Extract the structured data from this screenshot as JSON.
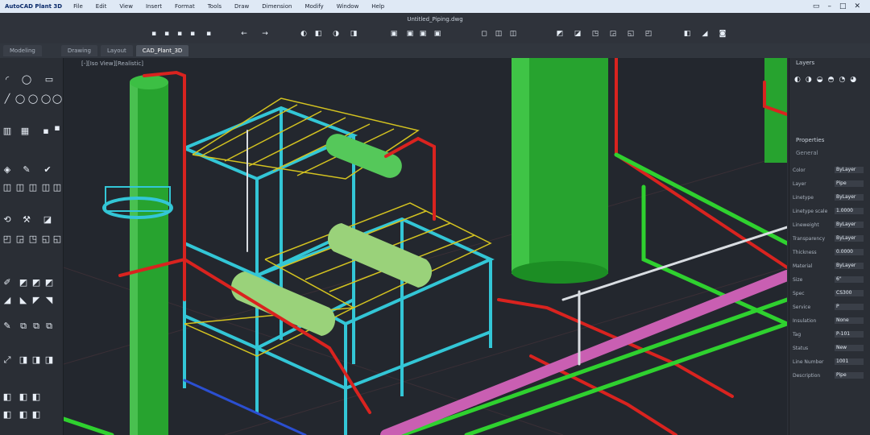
{
  "app": {
    "title": "AutoCAD Plant 3D",
    "document_title": "Untitled_Piping.dwg"
  },
  "menu": [
    "File",
    "Edit",
    "View",
    "Insert",
    "Format",
    "Tools",
    "Draw",
    "Dimension",
    "Modify",
    "Window",
    "Help"
  ],
  "tabs": [
    {
      "label": "Modeling"
    },
    {
      "label": "Drawing"
    },
    {
      "label": "Layout"
    },
    {
      "label": "CAD_Plant_3D"
    }
  ],
  "viewport": {
    "label": "[-][Iso View][Realistic]",
    "colors": {
      "background": "#23272e",
      "vessel": "#27a32f",
      "vessel_dark": "#137a1c",
      "structure_cyan": "#33c6d6",
      "grating_yellow": "#d4c320",
      "pipe_red": "#d9231f",
      "pipe_green": "#2fd12f",
      "pipe_magenta": "#c95fb2",
      "pipe_white": "#d9dde2",
      "pipe_blue": "#2b4fd1",
      "tank_green": "#9ad27a"
    }
  },
  "right_panel": {
    "title": "Layers",
    "section": "Properties",
    "subsection": "General",
    "rows": [
      {
        "label": "Color",
        "value": "ByLayer"
      },
      {
        "label": "Layer",
        "value": "Pipe"
      },
      {
        "label": "Linetype",
        "value": "ByLayer"
      },
      {
        "label": "Linetype scale",
        "value": "1.0000"
      },
      {
        "label": "Lineweight",
        "value": "ByLayer"
      },
      {
        "label": "Transparency",
        "value": "ByLayer"
      },
      {
        "label": "Thickness",
        "value": "0.0000"
      },
      {
        "label": "Material",
        "value": "ByLayer"
      },
      {
        "label": "Size",
        "value": "6\""
      },
      {
        "label": "Spec",
        "value": "CS300"
      },
      {
        "label": "Service",
        "value": "P"
      },
      {
        "label": "Insulation",
        "value": "None"
      },
      {
        "label": "Tag",
        "value": "P-101"
      },
      {
        "label": "Status",
        "value": "New"
      },
      {
        "label": "Line Number",
        "value": "1001"
      },
      {
        "label": "Description",
        "value": "Pipe"
      }
    ]
  },
  "icons": {
    "toolbar": [
      "new-icon",
      "open-icon",
      "save-icon",
      "print-icon",
      "undo-icon",
      "redo-icon",
      "layer-icon",
      "match-icon",
      "zoom-icon",
      "pan-icon",
      "orbit-icon",
      "measure-icon",
      "pipe-icon",
      "valve-icon",
      "fitting-icon",
      "support-icon",
      "equipment-icon",
      "iso-icon",
      "ortho-icon",
      "settings-icon",
      "help-icon"
    ]
  }
}
